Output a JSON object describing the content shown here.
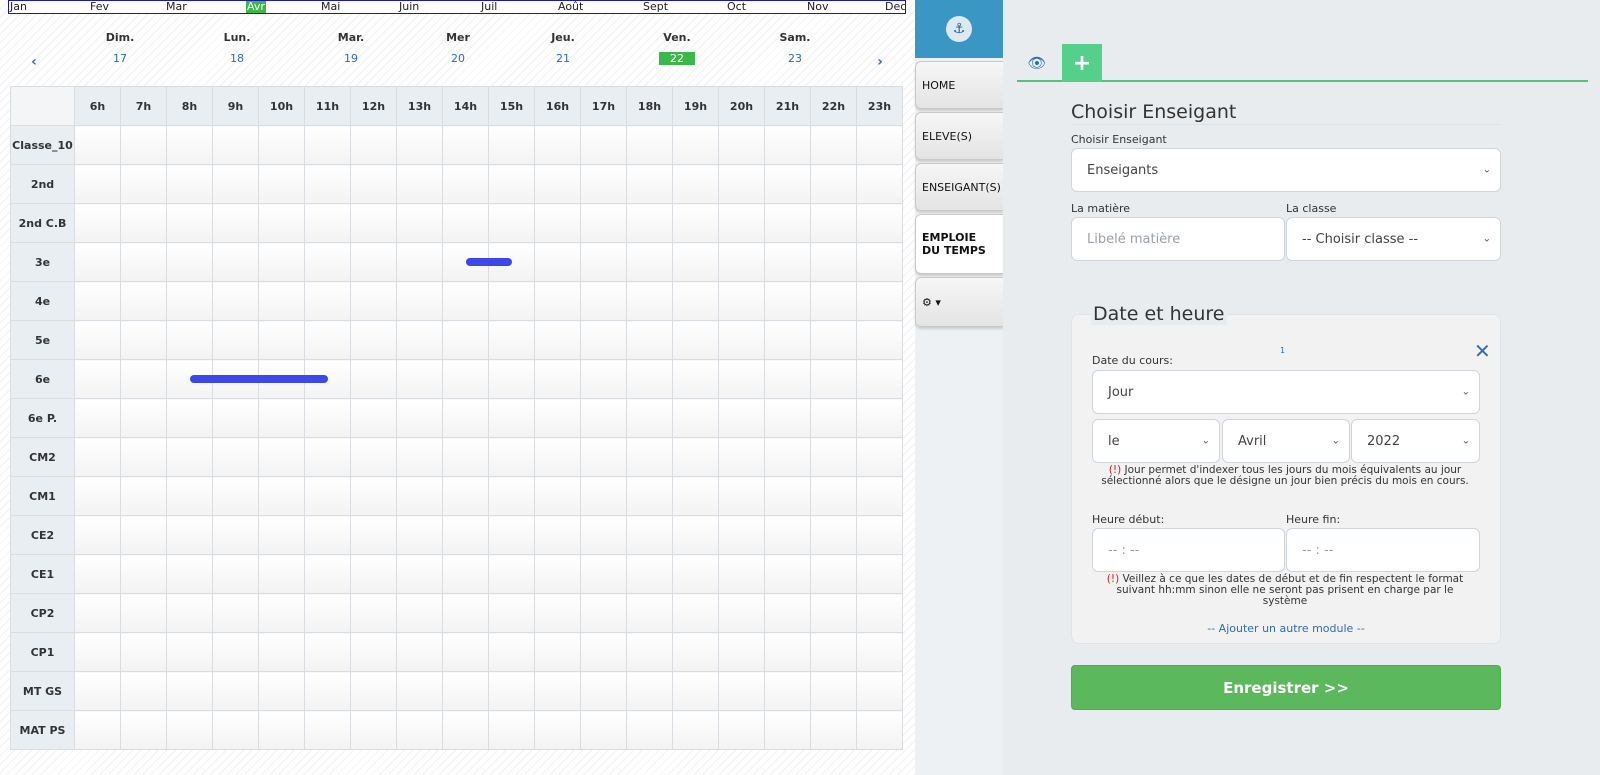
{
  "calendar": {
    "months": [
      {
        "label": "Jan",
        "active": false
      },
      {
        "label": "Fev",
        "active": false
      },
      {
        "label": "Mar",
        "active": false
      },
      {
        "label": "Avr",
        "active": true
      },
      {
        "label": "Mai",
        "active": false
      },
      {
        "label": "Juin",
        "active": false
      },
      {
        "label": "Juil",
        "active": false
      },
      {
        "label": "Août",
        "active": false
      },
      {
        "label": "Sept",
        "active": false
      },
      {
        "label": "Oct",
        "active": false
      },
      {
        "label": "Nov",
        "active": false
      },
      {
        "label": "Dec",
        "active": false
      }
    ],
    "prev_arrow": "‹",
    "next_arrow": "›",
    "days": [
      {
        "name": "Dim.",
        "num": "17",
        "today": false
      },
      {
        "name": "Lun.",
        "num": "18",
        "today": false
      },
      {
        "name": "Mar.",
        "num": "19",
        "today": false
      },
      {
        "name": "Mer",
        "num": "20",
        "today": false
      },
      {
        "name": "Jeu.",
        "num": "21",
        "today": false
      },
      {
        "name": "Ven.",
        "num": "22",
        "today": true
      },
      {
        "name": "Sam.",
        "num": "23",
        "today": false
      }
    ],
    "hours": [
      "6h",
      "7h",
      "8h",
      "9h",
      "10h",
      "11h",
      "12h",
      "13h",
      "14h",
      "15h",
      "16h",
      "17h",
      "18h",
      "19h",
      "20h",
      "21h",
      "22h",
      "23h"
    ],
    "classes": [
      "Classe_10",
      "2nd",
      "2nd C.B",
      "3e",
      "4e",
      "5e",
      "6e",
      "6e P.",
      "CM2",
      "CM1",
      "CE2",
      "CE1",
      "CP2",
      "CP1",
      "MT GS",
      "MAT PS"
    ],
    "events": [
      {
        "class": "3e",
        "start": "14h",
        "end": "15h",
        "color": "#3d48ea"
      },
      {
        "class": "6e",
        "start": "8h",
        "end": "11h",
        "color": "#3d48ea"
      }
    ]
  },
  "nav": {
    "logo_icon": "anchor-emblem",
    "items": [
      {
        "label": "HOME",
        "active": false
      },
      {
        "label": "ELEVE(S)",
        "active": false
      },
      {
        "label": "ENSEIGANT(S)",
        "active": false
      },
      {
        "label": "EMPLOIE DU TEMPS",
        "active": true
      }
    ],
    "gear_label": "⚙ ▾"
  },
  "tabs": {
    "view_icon": "eye-icon",
    "add_icon": "plus-icon",
    "view_glyph": "👁",
    "add_glyph": "+"
  },
  "form": {
    "title": "Choisir Enseigant",
    "teacher_label": "Choisir Enseigant",
    "teacher_value": "Enseigants",
    "subject_label": "La matière",
    "subject_placeholder": "Libelé matière",
    "class_label": "La classe",
    "class_value": "-- Choisir classe --",
    "datetime": {
      "title": "Date et heure",
      "index_marker": "1",
      "close_glyph": "✕",
      "date_label": "Date du cours:",
      "date_mode": "Jour",
      "day_value": "le",
      "month_value": "Avril",
      "year_value": "2022",
      "note1_warn": "(!)",
      "note1": "Jour permet d'indexer tous les jours du mois équivalents au jour sélectionné alors que le désigne un jour bien précis du mois en cours.",
      "start_label": "Heure début:",
      "end_label": "Heure fin:",
      "start_value": "-- : --",
      "end_value": "-- : --",
      "note2_warn": "(!)",
      "note2": "Veillez à ce que les dates de début et de fin respectent le format suivant hh:mm sinon elle ne seront pas prisent en charge par le système",
      "add_module": "-- Ajouter un autre module --"
    },
    "save_label": "Enregistrer >>"
  },
  "colors": {
    "accent_green": "#5cb85c",
    "event_blue": "#3d48ea",
    "link_blue": "#2a6fb5",
    "logo_bg": "#3a97c4"
  }
}
